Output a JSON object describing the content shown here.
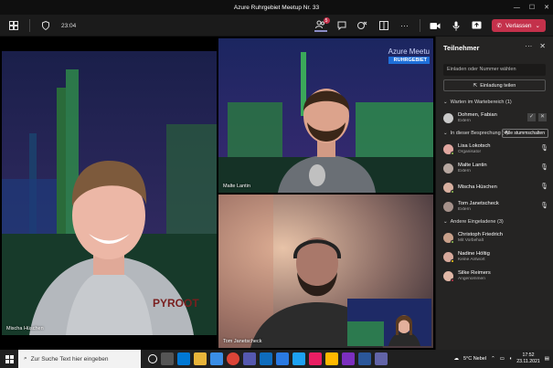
{
  "window": {
    "title": "Azure Ruhrgebiet Meetup Nr. 33",
    "minimize": "—",
    "maximize": "☐",
    "close": "✕"
  },
  "toolbar": {
    "timer": "23:04",
    "participants_badge": "5",
    "leave_label": "Verlassen"
  },
  "stage": {
    "tiles": [
      {
        "name": "Mischa Hüschen"
      },
      {
        "name": "Malte Lantin"
      },
      {
        "name": "Tom Janetscheck"
      }
    ],
    "banner": {
      "line1": "Azure Meetu",
      "line2": "RUHRGEBIET"
    }
  },
  "panel": {
    "title": "Teilnehmer",
    "more": "···",
    "close": "✕",
    "invite_placeholder": "Einladen oder Nummer wählen",
    "share_invite": "Einladung teilen",
    "waiting_header": "Warten im Wartebereich (1)",
    "waiting": [
      {
        "name": "Dohmen, Fabian",
        "role": "Extern"
      }
    ],
    "in_meeting_header": "In dieser Besprechung (4)",
    "mute_all": "Alle stummschalten",
    "in_meeting": [
      {
        "name": "Lisa Lokotsch",
        "role": "Organisator"
      },
      {
        "name": "Malte Lantin",
        "role": "Extern"
      },
      {
        "name": "Mischa Hüschen",
        "role": ""
      },
      {
        "name": "Tom Janetscheck",
        "role": "Extern"
      }
    ],
    "others_header": "Andere Eingeladene (3)",
    "others": [
      {
        "name": "Christoph Friedrich",
        "role": "Mit Vorbehalt"
      },
      {
        "name": "Nadine Höltig",
        "role": "Keine Antwort"
      },
      {
        "name": "Silke Reimers",
        "role": "Angenommen"
      }
    ]
  },
  "taskbar": {
    "search_placeholder": "Zur Suche Text hier eingeben",
    "weather": "5°C  Nebel",
    "time": "17:52",
    "date": "23.11.2021"
  }
}
